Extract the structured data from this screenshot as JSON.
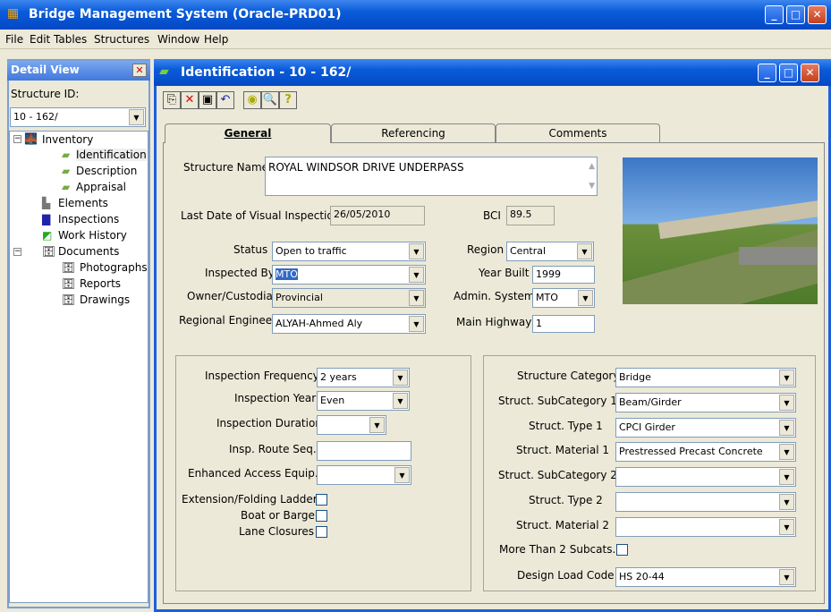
{
  "app": {
    "title": "Bridge Management System (Oracle-PRD01)"
  },
  "menu": [
    "File",
    "Edit",
    "Tables",
    "Structures",
    "Window",
    "Help"
  ],
  "detail": {
    "title": "Detail View",
    "structure_id_label": "Structure ID:",
    "structure_id": "10 - 162/",
    "tree": [
      "Inventory",
      "Identification",
      "Description",
      "Appraisal",
      "Elements",
      "Inspections",
      "Work History",
      "Documents",
      "Photographs",
      "Reports",
      "Drawings"
    ]
  },
  "child": {
    "title": "Identification - 10 - 162/"
  },
  "tabs": [
    "General",
    "Referencing",
    "Comments"
  ],
  "form": {
    "structure_name_label": "Structure Name",
    "structure_name": "ROYAL WINDSOR DRIVE UNDERPASS",
    "last_visual_label": "Last Date of Visual Inspection",
    "last_visual": "26/05/2010",
    "bci_label": "BCI",
    "bci": "89.5",
    "status_label": "Status",
    "status": "Open to traffic",
    "region_label": "Region",
    "region": "Central",
    "inspected_by_label": "Inspected By",
    "inspected_by": "MTO",
    "year_built_label": "Year Built",
    "year_built": "1999",
    "owner_label": "Owner/Custodian",
    "owner": "Provincial",
    "admin_label": "Admin. System",
    "admin": "MTO",
    "engineer_label": "Regional Engineer",
    "engineer": "ALYAH-Ahmed Aly",
    "highway_label": "Main Highway",
    "highway": "1"
  },
  "left_group": {
    "freq_label": "Inspection Frequency",
    "freq": "2 years",
    "year_label": "Inspection Year",
    "year": "Even",
    "duration_label": "Inspection Duration",
    "duration": "",
    "route_label": "Insp. Route Seq.",
    "route": "",
    "access_label": "Enhanced Access Equip.",
    "access": "",
    "ladder_label": "Extension/Folding Ladder",
    "boat_label": "Boat or Barge",
    "lane_label": "Lane Closures"
  },
  "right_group": {
    "category_label": "Structure Category",
    "category": "Bridge",
    "sub1_label": "Struct. SubCategory 1",
    "sub1": "Beam/Girder",
    "type1_label": "Struct. Type 1",
    "type1": "CPCI Girder",
    "mat1_label": "Struct. Material 1",
    "mat1": "Prestressed Precast Concrete",
    "sub2_label": "Struct. SubCategory 2",
    "sub2": "",
    "type2_label": "Struct. Type 2",
    "type2": "",
    "mat2_label": "Struct. Material 2",
    "mat2": "",
    "more_label": "More Than 2 Subcats.",
    "load_label": "Design Load Code",
    "load": "HS 20-44"
  }
}
